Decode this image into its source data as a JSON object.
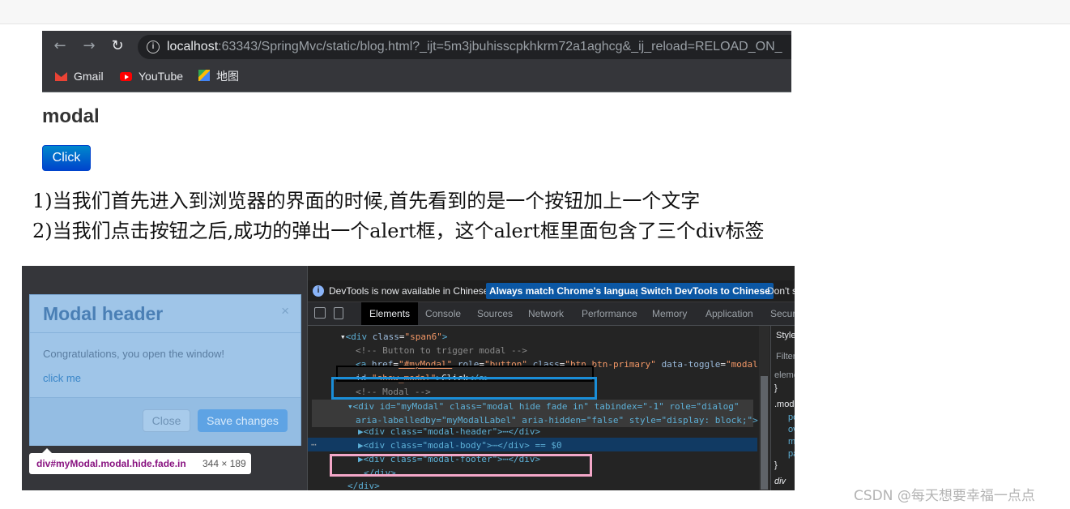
{
  "browser": {
    "url_host": "localhost",
    "url_rest": ":63343/SpringMvc/static/blog.html?_ijt=5m3jbuhisscpkhkrm72a1aghcg&_ij_reload=RELOAD_ON_",
    "bookmarks": [
      {
        "label": "Gmail",
        "icon": "gmail-icon"
      },
      {
        "label": "YouTube",
        "icon": "youtube-icon"
      },
      {
        "label": "地图",
        "icon": "maps-icon"
      }
    ]
  },
  "page": {
    "heading": "modal",
    "button_label": "Click"
  },
  "notes": {
    "line1": "1)当我们首先进入到浏览器的界面的时候,首先看到的是一个按钮加上一个文字",
    "line2": "2)当我们点击按钮之后,成功的弹出一个alert框，这个alert框里面包含了三个div标签"
  },
  "modal": {
    "header": "Modal header",
    "close_x": "×",
    "body_text": "Congratulations, you open the window!",
    "link_text": "click me",
    "close_label": "Close",
    "save_label": "Save changes"
  },
  "tooltip": {
    "selector": "div#myModal.modal.hide.fade.in",
    "dims": "344 × 189"
  },
  "devtools": {
    "info_text": "DevTools is now available in Chinese!",
    "btn_match": "Always match Chrome's language",
    "btn_switch": "Switch DevTools to Chinese",
    "btn_dont": "Don't s",
    "tabs": [
      "Elements",
      "Console",
      "Sources",
      "Network",
      "Performance",
      "Memory",
      "Application",
      "Securi"
    ],
    "side_tab": "Style",
    "side_lines": [
      "Filter",
      "eleme",
      "}",
      ".moda",
      "po",
      "ov",
      "ma",
      "pa",
      "}",
      "div"
    ]
  },
  "code_lines": {
    "l1_tag": "div",
    "l1_attr": "class",
    "l1_val": "\"span6\"",
    "l2": "<!-- Button to trigger modal -->",
    "l3a": "<a",
    "l3_href": "href",
    "l3_hrefv": "\"#myModal\"",
    "l3_role": "role",
    "l3_rolev": "\"button\"",
    "l3_class": "class",
    "l3_classv": "\"btn btn-primary\"",
    "l3_dt": "data-toggle",
    "l3_dtv": "\"modal\"",
    "l4_id": "id",
    "l4_idv": "\"show_modal\"",
    "l4_text": "Click",
    "l4_end": "</a>",
    "l5": "<!-- Modal -->",
    "l6": "<div id=\"myModal\" class=\"modal hide fade in\" tabindex=\"-1\" role=\"dialog\"",
    "l7": "aria-labelledby=\"myModalLabel\" aria-hidden=\"false\" style=\"display: block;\">",
    "l8": "▶<div class=\"modal-header\">⋯</div>",
    "l9": "▶<div class=\"modal-body\">⋯</div> == $0",
    "l10": "▶<div class=\"modal-footer\">⋯</div>",
    "l11": "</div>",
    "l12": "</div>"
  },
  "watermark": "CSDN @每天想要幸福一点点"
}
